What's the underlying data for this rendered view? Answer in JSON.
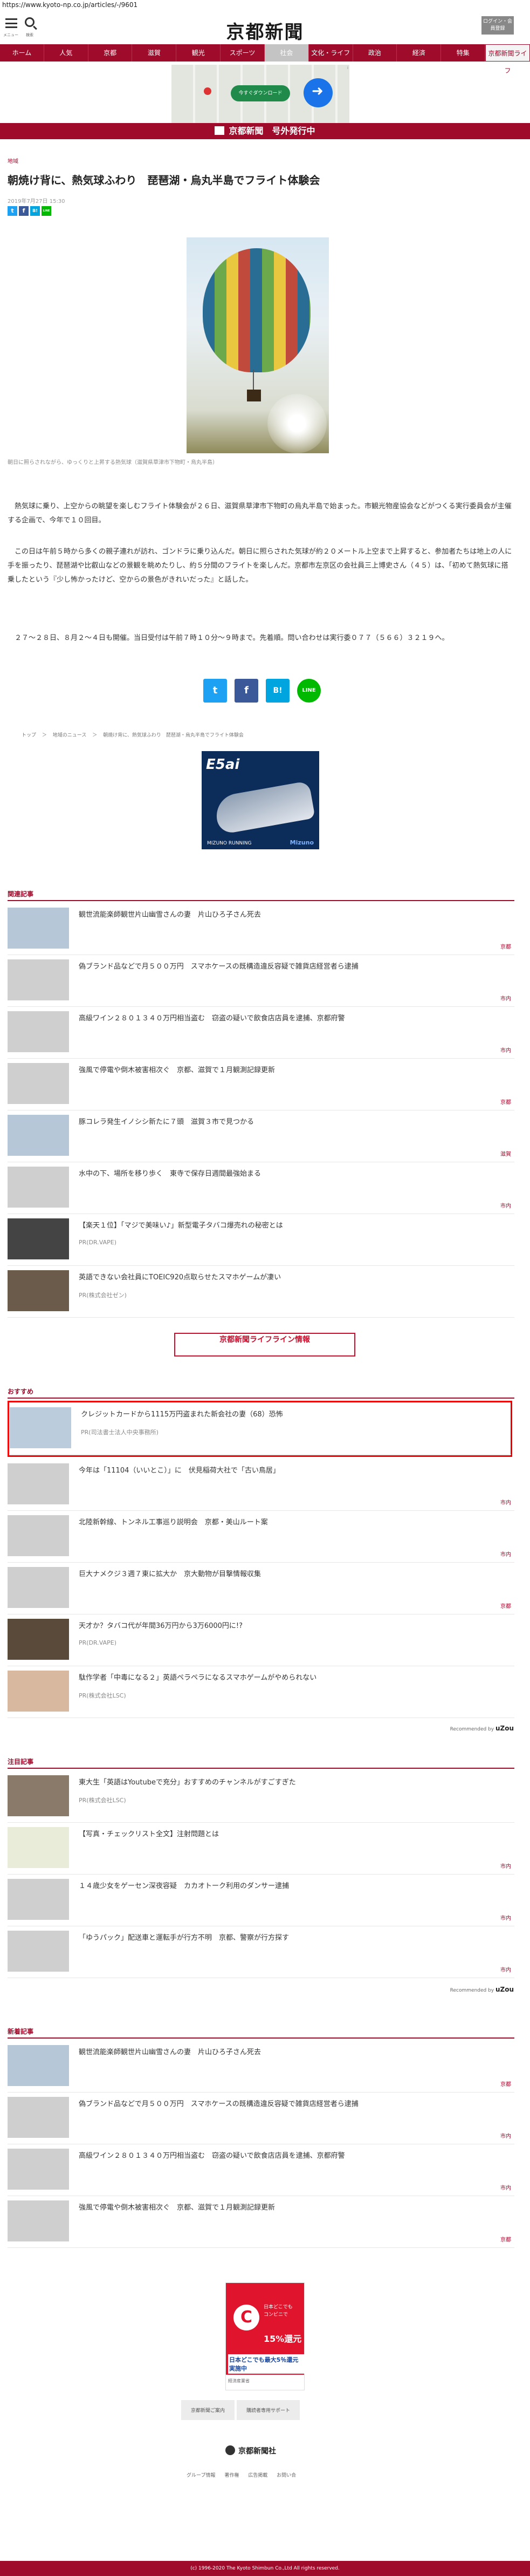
{
  "url": "https://www.kyoto-np.co.jp/articles/-/9601",
  "header": {
    "menu_label": "メニュー",
    "search_label": "検索",
    "logo": "京都新聞",
    "login_label": "ログイン・会員登録"
  },
  "nav": [
    "ホーム",
    "人気",
    "京都",
    "滋賀",
    "観光",
    "スポーツ",
    "社会",
    "文化・ライフ",
    "政治",
    "経済",
    "特集",
    "京都新聞ライフ"
  ],
  "top_ad": {
    "button": "今すぐダウンロード",
    "ad_mark": "i"
  },
  "issue_banner": "京都新聞　号外発行中",
  "article": {
    "category": "地域",
    "title": "朝焼け背に、熱気球ふわり　琵琶湖・烏丸半島でフライト体験会",
    "date": "2019年7月27日 15:30",
    "caption": "朝日に照らされながら、ゆっくりと上昇する熱気球（滋賀県草津市下物町・烏丸半島）",
    "paragraphs": [
      "　熱気球に乗り、上空からの眺望を楽しむフライト体験会が２６日、滋賀県草津市下物町の烏丸半島で始まった。市観光物産協会などがつくる実行委員会が主催する企画で、今年で１０回目。",
      "　この日は午前５時から多くの親子連れが訪れ、ゴンドラに乗り込んだ。朝日に照らされた気球が約２０メートル上空まで上昇すると、参加者たちは地上の人に手を振ったり、琵琶湖や比叡山などの景観を眺めたりし、約５分間のフライトを楽しんだ。京都市左京区の会社員三上博史さん（４５）は、「初めて熱気球に搭乗したという『少し怖かったけど、空からの景色がきれいだった』と話した。",
      "　２７～２８日、８月２～４日も開催。当日受付は午前７時１０分～９時まで。先着順。問い合わせは実行委０７７（５６６）３２１９へ。"
    ]
  },
  "share": {
    "twitter": "t",
    "facebook": "f",
    "hatena": "B!",
    "line": "LINE"
  },
  "breadcrumb": [
    "トップ",
    "＞",
    "地域のニュース",
    "＞",
    "朝焼け背に、熱気球ふわり　琵琶湖・烏丸半島でフライト体験会"
  ],
  "shoe_ad": {
    "model": "E5ai",
    "brand": "MIZUNO RUNNING",
    "maker": "Mizuno"
  },
  "related": {
    "title": "関連記事",
    "items": [
      {
        "title": "観世流能楽師観世片山幽雪さんの妻　片山ひろ子さん死去",
        "tag": "京都"
      },
      {
        "title": "偽ブランド品などで月５００万円　スマホケースの既構造違反容疑で雑貨店経営者ら逮捕",
        "tag": "市内"
      },
      {
        "title": "高級ワイン２８０１３４０万円相当盗む　窃盗の疑いで飲食店店員を逮捕、京都府警",
        "tag": "市内"
      },
      {
        "title": "強風で停電や倒木被害相次ぐ　京都、滋賀で１月観測記録更新",
        "tag": "京都"
      },
      {
        "title": "豚コレラ発生イノシシ新たに７頭　滋賀３市で見つかる",
        "tag": "滋賀"
      },
      {
        "title": "水中の下、場所を移り歩く　東寺で保存日週間最強始まる",
        "tag": "市内"
      },
      {
        "title": "【楽天１位】「マジで美味い♪」新型電子タバコ爆売れの秘密とは",
        "pr": "PR(DR.VAPE)"
      },
      {
        "title": "英語できない会社員にTOEIC920点取らせたスマホゲームが凄い",
        "pr": "PR(株式会社ゼン)"
      }
    ]
  },
  "lifeline": "京都新聞ライフライン情報",
  "recommend": {
    "title": "おすすめ",
    "items": [
      {
        "title": "クレジットカードから1115万円盗まれた新会社の妻（68）恐怖",
        "pr": "PR(司法書士法人中央事務所)"
      },
      {
        "title": "今年は「11104（いいとこ）」に　伏見稲荷大社で「古い鳥居」",
        "tag": "市内"
      },
      {
        "title": "北陸新幹線、トンネル工事巡り説明会　京都・美山ルート案",
        "tag": "市内"
      },
      {
        "title": "巨大ナメクジ３週７東に拡大か　京大動物が目撃情報収集",
        "tag": "京都"
      },
      {
        "title": "天才か？タバコ代が年間36万円から3万6000円に!?",
        "pr": "PR(DR.VAPE)"
      },
      {
        "title": "駄作学者「中毒になる２」英語ペラペラになるスマホゲームがやめられない",
        "pr": "PR(株式会社LSC)"
      }
    ],
    "credit": "Recommended by",
    "brand": "uZou"
  },
  "notice": {
    "title": "注目記事",
    "items": [
      {
        "title": "東大生「英語はYoutubeで充分」おすすめのチャンネルがすごすぎた",
        "pr": "PR(株式会社LSC)"
      },
      {
        "title": "【写真・チェックリスト全文】注射問題とは",
        "tag": "市内"
      },
      {
        "title": "１４歳少女をゲーセン深夜容疑　カカオトーク利用のダンサー逮捕",
        "tag": "市内"
      },
      {
        "title": "「ゆうパック」配送車と運転手が行方不明　京都、警察が行方探す",
        "tag": "市内"
      }
    ],
    "credit": "Recommended by",
    "brand": "uZou"
  },
  "new_articles": {
    "title": "新着記事",
    "items": [
      {
        "title": "観世流能楽師観世片山幽雪さんの妻　片山ひろ子さん死去",
        "tag": "京都"
      },
      {
        "title": "偽ブランド品などで月５００万円　スマホケースの既構造違反容疑で雑貨店経営者ら逮捕",
        "tag": "市内"
      },
      {
        "title": "高級ワイン２８０１３４０万円相当盗む　窃盗の疑いで飲食店店員を逮捕、京都府警",
        "tag": "市内"
      },
      {
        "title": "強風で停電や倒木被害相次ぐ　京都、滋賀で１月観測記録更新",
        "tag": "京都"
      }
    ]
  },
  "card_ad": {
    "mark": "C",
    "line1": "日本どこでも",
    "line2": "コンビニで",
    "rate": "15%還元",
    "headline": "日本どこでも最大5％還元 実施中",
    "sponsor": "経済産業省"
  },
  "footer": {
    "buttons": [
      "京都新聞ご案内",
      "購読者専用サポート"
    ],
    "logo": "京都新聞社",
    "links": [
      "グループ情報",
      "著作権",
      "広告掲載",
      "お問い合"
    ],
    "copyright": "(c) 1996-2020 The Kyoto Shimbun Co.,Ltd All rights reserved."
  },
  "colors": {
    "brand": "#9e0b2b",
    "twitter": "#1da1f2",
    "facebook": "#3b5998",
    "hatena": "#00a4de",
    "line": "#00b900"
  }
}
